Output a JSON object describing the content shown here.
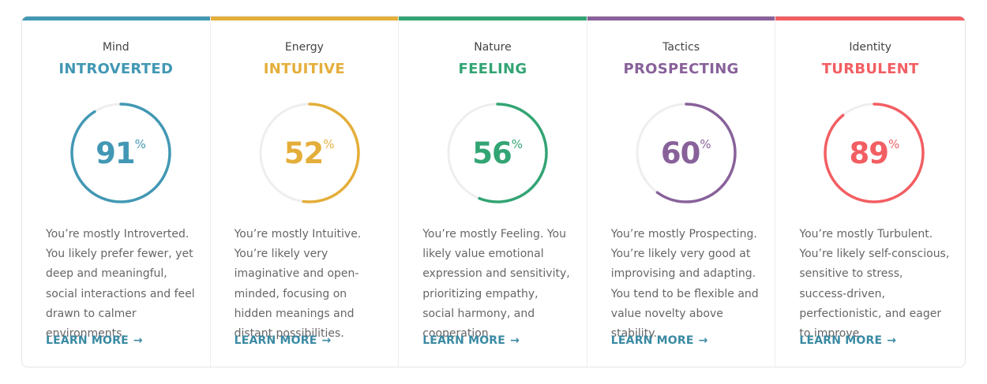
{
  "cards": [
    {
      "category": "Mind",
      "trait": "INTROVERTED",
      "percent": 91,
      "percent_sign": "%",
      "color": "#4298b4",
      "description": "You’re mostly Introverted. You likely prefer fewer, yet deep and meaningful, social interactions and feel drawn to calmer environments.",
      "link": "LEARN MORE",
      "link_icon": "arrow-right-icon"
    },
    {
      "category": "Energy",
      "trait": "INTUITIVE",
      "percent": 52,
      "percent_sign": "%",
      "color": "#e4ae3a",
      "description": "You’re mostly Intuitive. You’re likely very imaginative and open-minded, focusing on hidden meanings and distant possibilities.",
      "link": "LEARN MORE",
      "link_icon": "arrow-right-icon"
    },
    {
      "category": "Nature",
      "trait": "FEELING",
      "percent": 56,
      "percent_sign": "%",
      "color": "#33a474",
      "description": "You’re mostly Feeling. You likely value emotional expression and sensitivity, prioritizing empathy, social harmony, and cooperation.",
      "link": "LEARN MORE",
      "link_icon": "arrow-right-icon"
    },
    {
      "category": "Tactics",
      "trait": "PROSPECTING",
      "percent": 60,
      "percent_sign": "%",
      "color": "#88619a",
      "description": "You’re mostly Prospecting. You’re likely very good at improvising and adapting. You tend to be flexible and value novelty above stability.",
      "link": "LEARN MORE",
      "link_icon": "arrow-right-icon"
    },
    {
      "category": "Identity",
      "trait": "TURBULENT",
      "percent": 89,
      "percent_sign": "%",
      "color": "#f25e62",
      "description": "You’re mostly Turbulent. You’re likely self-conscious, sensitive to stress, success-driven, perfectionistic, and eager to improve.",
      "link": "LEARN MORE",
      "link_icon": "arrow-right-icon"
    }
  ],
  "track_color": "#eeeeee",
  "link_color": "#3a8aa3"
}
